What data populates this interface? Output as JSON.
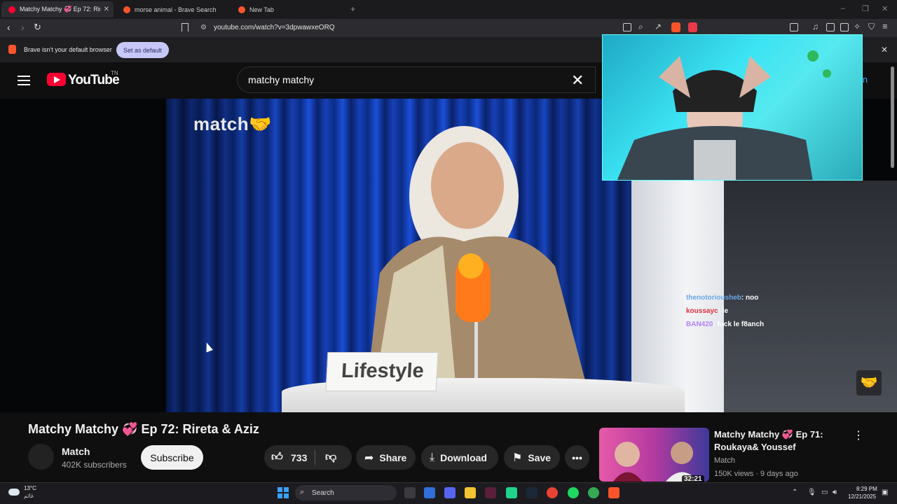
{
  "tabs": [
    {
      "label": "Matchy Matchy 💞 Ep 72: Rireta",
      "active": true
    },
    {
      "label": "morse animal - Brave Search",
      "active": false
    },
    {
      "label": "New Tab",
      "active": false
    }
  ],
  "address": {
    "url": "youtube.com/watch?v=3dpwawxeORQ"
  },
  "infobar": {
    "message": "Brave isn't your default browser",
    "action": "Set as default"
  },
  "youtube": {
    "logo_text": "YouTube",
    "region": "TN",
    "search_value": "matchy matchy",
    "signin_partial": "in"
  },
  "video": {
    "brand_overlay": "match🤝",
    "placard": "Lifestyle",
    "chat": [
      {
        "user": "thenotoriousheb",
        "msg": ": noo"
      },
      {
        "user": "koussayc",
        "msg": ": le"
      },
      {
        "user": "BAN420",
        "msg": ": fuck le f8anch"
      }
    ]
  },
  "details": {
    "title": "Matchy Matchy 💞 Ep 72: Rireta & Aziz",
    "channel": "Match",
    "subscribers": "402K subscribers",
    "subscribe": "Subscribe",
    "likes": "733",
    "share": "Share",
    "download": "Download",
    "save": "Save"
  },
  "recommendation": {
    "title": "Matchy Matchy 💞 Ep 71: Roukaya& Youssef",
    "channel": "Match",
    "meta": "150K views · 9 days ago",
    "duration": "32:21"
  },
  "taskbar": {
    "weather_temp": "13°C",
    "weather_label": "غائم",
    "search": "Search",
    "time": "8:29 PM",
    "date": "12/21/2025"
  },
  "colors": {
    "accent_youtube": "#ff0033",
    "brave_orange": "#fb542b",
    "link_blue": "#3ea6ff"
  }
}
